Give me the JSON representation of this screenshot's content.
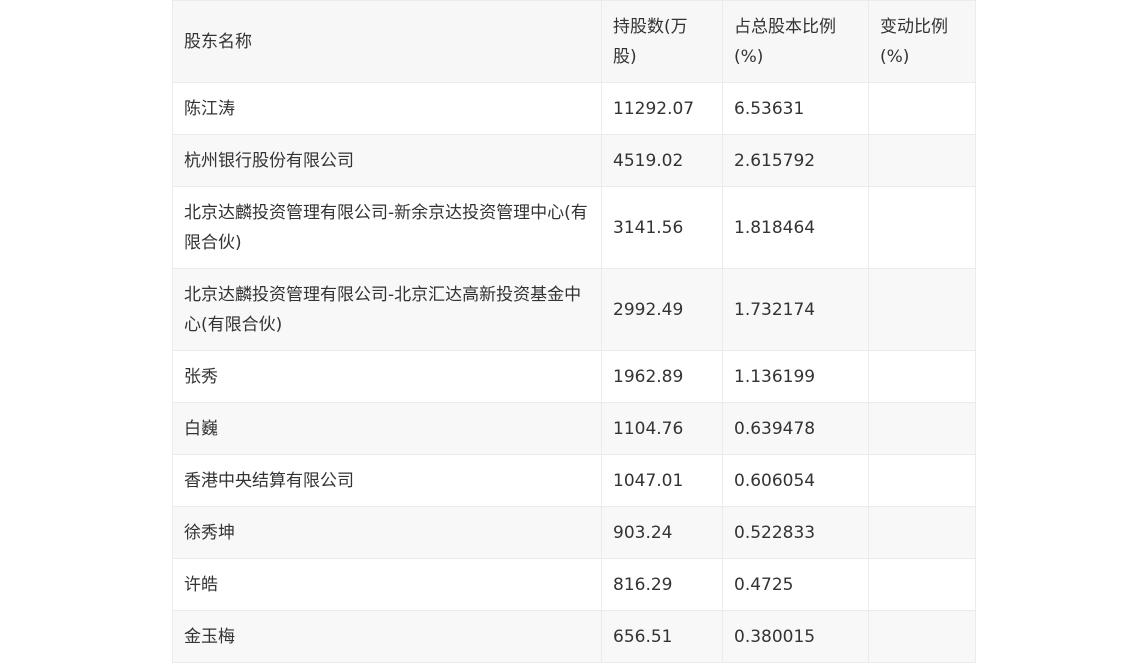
{
  "table": {
    "headers": [
      "股东名称",
      "持股数(万股)",
      "占总股本比例(%)",
      "变动比例(%)"
    ],
    "rows": [
      [
        "陈江涛",
        "11292.07",
        "6.53631",
        ""
      ],
      [
        "杭州银行股份有限公司",
        "4519.02",
        "2.615792",
        ""
      ],
      [
        "北京达麟投资管理有限公司-新余京达投资管理中心(有限合伙)",
        "3141.56",
        "1.818464",
        ""
      ],
      [
        "北京达麟投资管理有限公司-北京汇达高新投资基金中心(有限合伙)",
        "2992.49",
        "1.732174",
        ""
      ],
      [
        "张秀",
        "1962.89",
        "1.136199",
        ""
      ],
      [
        "白巍",
        "1104.76",
        "0.639478",
        ""
      ],
      [
        "香港中央结算有限公司",
        "1047.01",
        "0.606054",
        ""
      ],
      [
        "徐秀坤",
        "903.24",
        "0.522833",
        ""
      ],
      [
        "许皓",
        "816.29",
        "0.4725",
        ""
      ],
      [
        "金玉梅",
        "656.51",
        "0.380015",
        ""
      ]
    ]
  }
}
